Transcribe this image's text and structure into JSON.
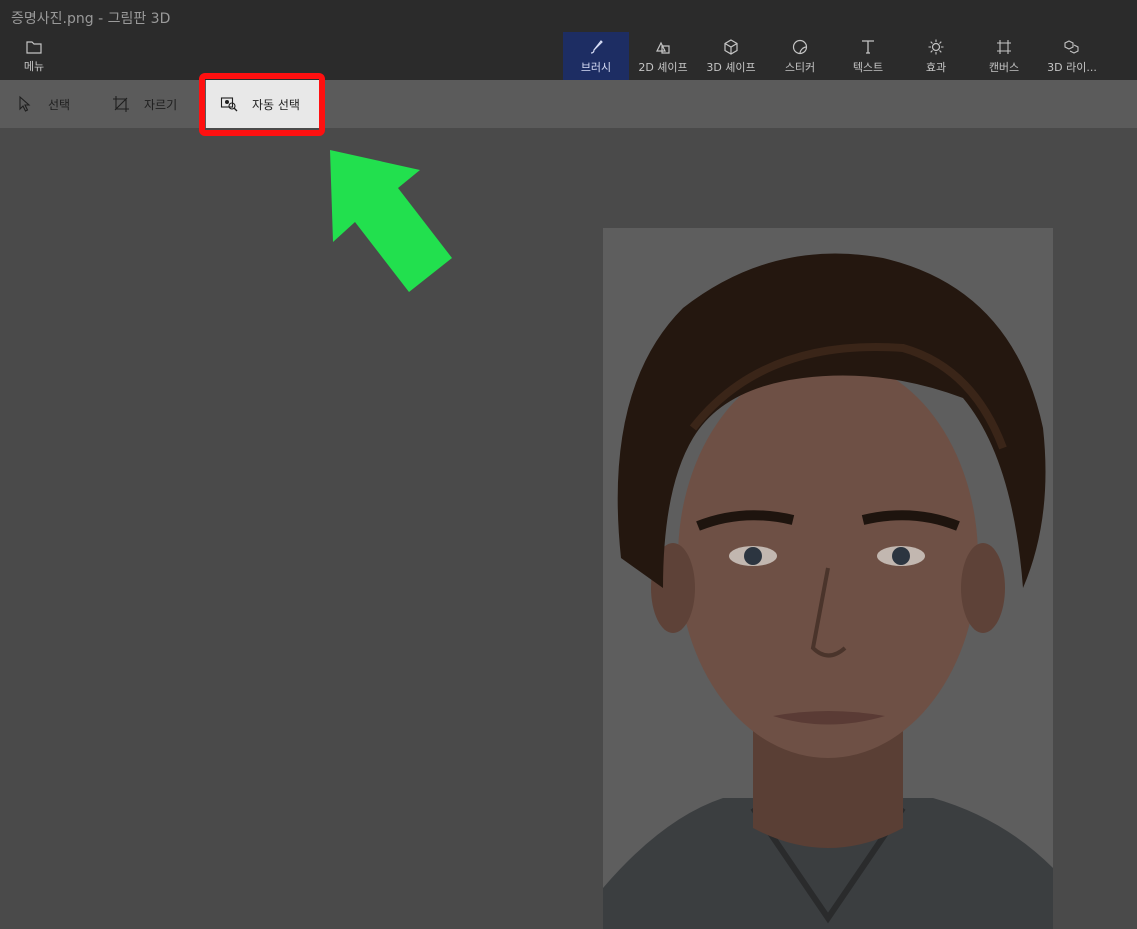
{
  "window": {
    "title": "증명사진.png - 그림판 3D"
  },
  "menu": {
    "label": "메뉴",
    "icon": "folder-icon"
  },
  "ribbon_tools": [
    {
      "label": "브러시",
      "icon": "brush-icon",
      "active": true
    },
    {
      "label": "2D 셰이프",
      "icon": "2d-shapes-icon",
      "active": false
    },
    {
      "label": "3D 셰이프",
      "icon": "3d-shapes-icon",
      "active": false
    },
    {
      "label": "스티커",
      "icon": "sticker-icon",
      "active": false
    },
    {
      "label": "텍스트",
      "icon": "text-icon",
      "active": false
    },
    {
      "label": "효과",
      "icon": "effects-icon",
      "active": false
    },
    {
      "label": "캔버스",
      "icon": "canvas-icon",
      "active": false
    },
    {
      "label": "3D 라이...",
      "icon": "3d-library-icon",
      "active": false
    }
  ],
  "subbar": {
    "select": {
      "label": "선택",
      "icon": "cursor-icon"
    },
    "crop": {
      "label": "자르기",
      "icon": "crop-icon"
    },
    "magic_select": {
      "label": "자동 선택",
      "icon": "magic-select-icon"
    }
  },
  "annotation": {
    "highlight_color": "#ff1010",
    "arrow_color": "#22e04e"
  },
  "colors": {
    "active_tool_bg": "#1d2d63",
    "ribbon_bg": "#2b2b2b",
    "canvas_bg": "#4a4a4a"
  }
}
